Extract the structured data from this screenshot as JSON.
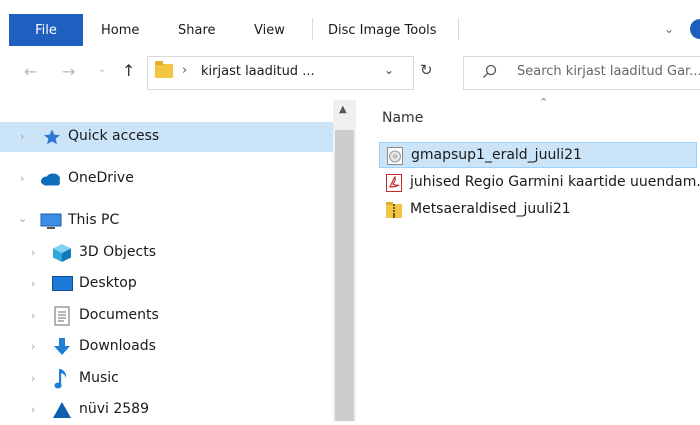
{
  "ribbon": {
    "tabs": [
      "File",
      "Home",
      "Share",
      "View",
      "Disc Image Tools"
    ]
  },
  "address": {
    "path_separator": "›",
    "current_folder": "kirjast laaditud ...",
    "search_placeholder": "Search kirjast laaditud Gar..."
  },
  "nav": {
    "items": [
      {
        "label": "Quick access",
        "icon": "star-icon"
      },
      {
        "label": "OneDrive",
        "icon": "cloud-icon"
      },
      {
        "label": "This PC",
        "icon": "computer-icon"
      },
      {
        "label": "3D Objects",
        "icon": "cube-icon"
      },
      {
        "label": "Desktop",
        "icon": "desktop-icon"
      },
      {
        "label": "Documents",
        "icon": "document-icon"
      },
      {
        "label": "Downloads",
        "icon": "download-icon"
      },
      {
        "label": "Music",
        "icon": "music-icon"
      },
      {
        "label": "nüvi 2589",
        "icon": "device-icon"
      }
    ]
  },
  "content": {
    "column_name": "Name",
    "files": [
      {
        "name": "gmapsup1_erald_juuli21",
        "icon": "disc-image-icon"
      },
      {
        "name": "juhised Regio Garmini kaartide uuendam...",
        "icon": "pdf-icon"
      },
      {
        "name": "Metsaeraldised_juuli21",
        "icon": "zip-folder-icon"
      }
    ]
  },
  "colors": {
    "accent": "#1f5fbf",
    "selection": "#cce4f7",
    "selection_border": "#99d1ff"
  }
}
